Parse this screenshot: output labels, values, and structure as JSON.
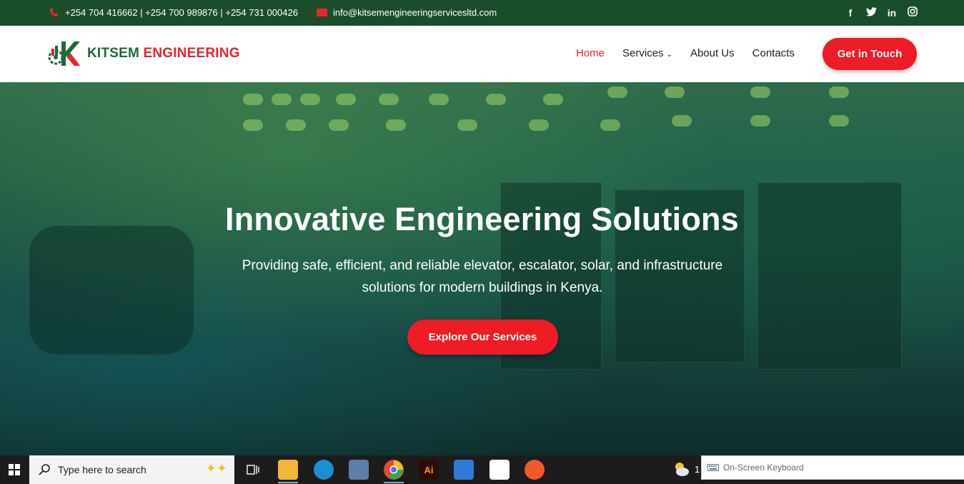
{
  "topbar": {
    "phones": "+254 704 416662 | +254 700 989876 | +254 731 000426",
    "email": "info@kitsemengineeringservicesltd.com",
    "social_icons": [
      "facebook-icon",
      "twitter-icon",
      "linkedin-icon",
      "instagram-icon"
    ]
  },
  "brand": {
    "part1": "KITSEM",
    "part2": "ENGINEERING"
  },
  "nav": {
    "home": "Home",
    "services": "Services",
    "about": "About Us",
    "contacts": "Contacts",
    "cta": "Get in Touch"
  },
  "hero": {
    "title": "Innovative Engineering Solutions",
    "subtitle": "Providing safe, efficient, and reliable elevator, escalator, solar, and infrastructure solutions for modern buildings in Kenya.",
    "button": "Explore Our Services"
  },
  "taskbar": {
    "search_placeholder": "Type here to search",
    "weather_text": "1",
    "osk_label": "On-Screen Keyboard"
  },
  "colors": {
    "accent_red": "#ee1c25",
    "brand_green": "#1f6a3a",
    "topbar_green": "#1a4d2a"
  }
}
